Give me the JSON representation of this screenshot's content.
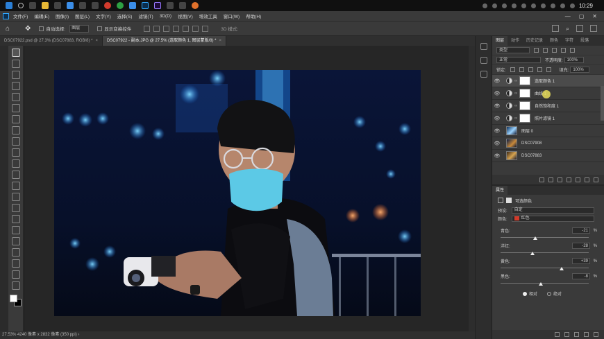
{
  "taskbar": {
    "clock": "10:29"
  },
  "menu": {
    "items": [
      "文件(F)",
      "编辑(E)",
      "图像(I)",
      "图层(L)",
      "文字(Y)",
      "选择(S)",
      "滤镜(T)",
      "3D(D)",
      "视图(V)",
      "增效工具",
      "窗口(W)",
      "帮助(H)"
    ],
    "minimize": "—",
    "maximize": "▢",
    "close": "✕"
  },
  "options": {
    "auto_select_label": "自动选择:",
    "auto_select_value": "图层",
    "show_transform_label": "显示变换控件",
    "mode_3d": "3D 模式:"
  },
  "tabs": [
    {
      "label": "DSC07922.psd @ 27.3% (DSC07883, RGB/8) *",
      "active": false,
      "close": "×"
    },
    {
      "label": "DSC07922 - 副本.JPG @ 27.5% (选取颜色 1, 图层蒙版/8) *",
      "active": true,
      "close": "×"
    }
  ],
  "status": {
    "text": "27.53%   4240 像素 x 2832 像素 (350 ppi)   ›"
  },
  "layers_panel": {
    "tabs": [
      "图层",
      "动作",
      "历史记录",
      "颜色",
      "字符",
      "段落"
    ],
    "kind_label": "类型",
    "blend_mode": "正常",
    "opacity_label": "不透明度:",
    "opacity_value": "100%",
    "lock_label": "锁定:",
    "fill_label": "填充:",
    "fill_value": "100%",
    "layers": [
      {
        "name": "选取颜色 1",
        "type": "adjustment",
        "selected": true
      },
      {
        "name": "曲线 1",
        "type": "adjustment",
        "selected": false
      },
      {
        "name": "自然饱和度 1",
        "type": "adjustment",
        "selected": false
      },
      {
        "name": "照片滤镜 1",
        "type": "adjustment",
        "selected": false
      },
      {
        "name": "图层 0",
        "type": "pixel",
        "selected": false
      },
      {
        "name": "DSC07908",
        "type": "pixel",
        "selected": false
      },
      {
        "name": "DSC07883",
        "type": "pixel",
        "selected": false
      }
    ]
  },
  "properties_panel": {
    "tabs": [
      "属性"
    ],
    "title": "可选颜色",
    "preset_label": "预设:",
    "preset_value": "自定",
    "color_label": "颜色:",
    "color_value": "红色",
    "color_swatch": "#d23a2a",
    "sliders": [
      {
        "label": "青色:",
        "value": "-21",
        "unit": "%",
        "fraction": 0.395
      },
      {
        "label": "洋红:",
        "value": "-28",
        "unit": "%",
        "fraction": 0.36
      },
      {
        "label": "黄色:",
        "value": "+39",
        "unit": "%",
        "fraction": 0.695
      },
      {
        "label": "黑色:",
        "value": "-8",
        "unit": "%",
        "fraction": 0.46
      }
    ],
    "method_relative": "相对",
    "method_absolute": "绝对"
  }
}
